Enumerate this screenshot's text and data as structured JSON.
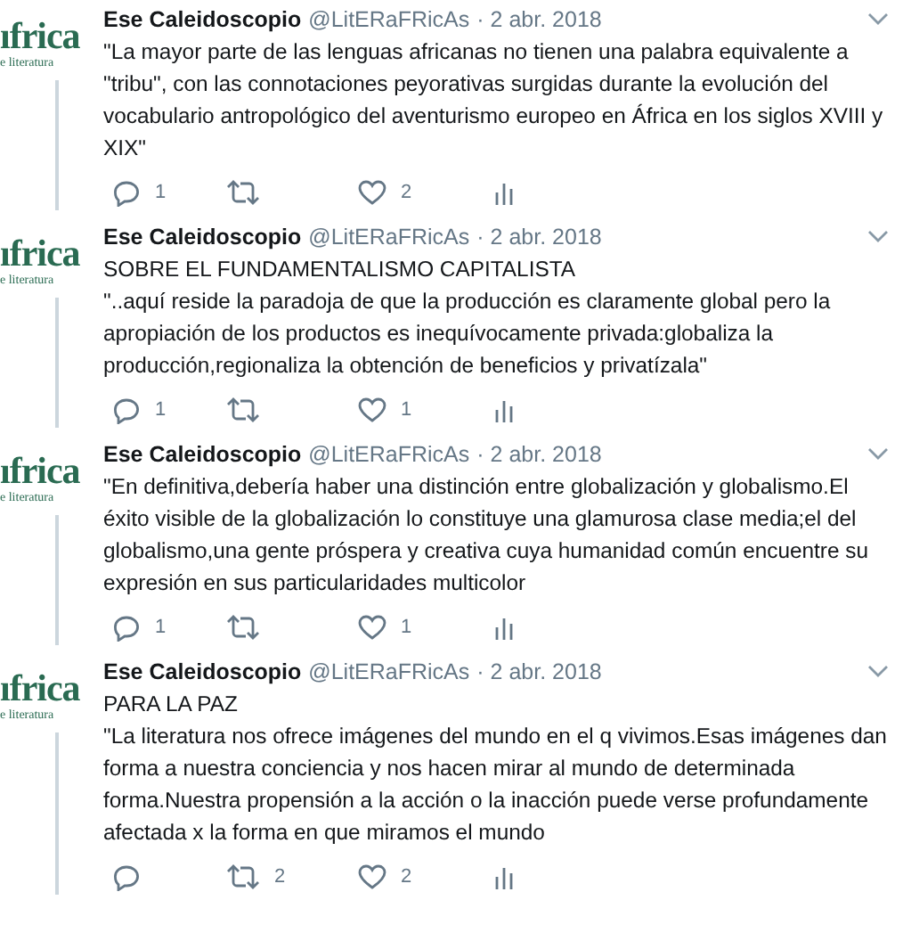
{
  "tweets": [
    {
      "avatar": {
        "logo": "ıfrica",
        "subtitle": "e literatura"
      },
      "name": "Ese Caleidoscopio",
      "handle": "@LitERaFRicAs",
      "date": "· 2 abr. 2018",
      "paragraphs": [
        "\"La mayor parte de las lenguas africanas no tienen una palabra equivalente a \"tribu\", con las connotaciones peyorativas surgidas durante la evolución del vocabulario antropológico del aventurismo europeo en África en los siglos XVIII y XIX\""
      ],
      "reply_count": "1",
      "like_count": "2"
    },
    {
      "avatar": {
        "logo": "ıfrica",
        "subtitle": "e literatura"
      },
      "name": "Ese Caleidoscopio",
      "handle": "@LitERaFRicAs",
      "date": "· 2 abr. 2018",
      "paragraphs": [
        "SOBRE EL FUNDAMENTALISMO CAPITALISTA",
        "\"..aquí reside la paradoja de que la producción es claramente global pero la apropiación de los productos es inequívocamente privada:globaliza la producción,regionaliza la obtención de beneficios y privatízala\""
      ],
      "reply_count": "1",
      "like_count": "1"
    },
    {
      "avatar": {
        "logo": "ıfrica",
        "subtitle": "e literatura"
      },
      "name": "Ese Caleidoscopio",
      "handle": "@LitERaFRicAs",
      "date": "· 2 abr. 2018",
      "paragraphs": [
        "\"En definitiva,debería haber una distinción entre globalización y globalismo.El éxito visible de la globalización lo constituye una glamurosa clase media;el del globalismo,una gente próspera y creativa cuya humanidad común encuentre su expresión en sus particularidades multicolor"
      ],
      "reply_count": "1",
      "like_count": "1"
    },
    {
      "avatar": {
        "logo": "ıfrica",
        "subtitle": "e literatura"
      },
      "name": "Ese Caleidoscopio",
      "handle": "@LitERaFRicAs",
      "date": "· 2 abr. 2018",
      "paragraphs": [
        "PARA LA PAZ",
        "\"La literatura nos ofrece imágenes del mundo en el q vivimos.Esas imágenes dan forma a nuestra conciencia y nos hacen mirar al mundo de determinada forma.Nuestra propensión a la acción o la inacción puede verse profundamente afectada x la forma en que miramos el mundo"
      ],
      "retweet_count": "2",
      "like_count": "2"
    }
  ]
}
